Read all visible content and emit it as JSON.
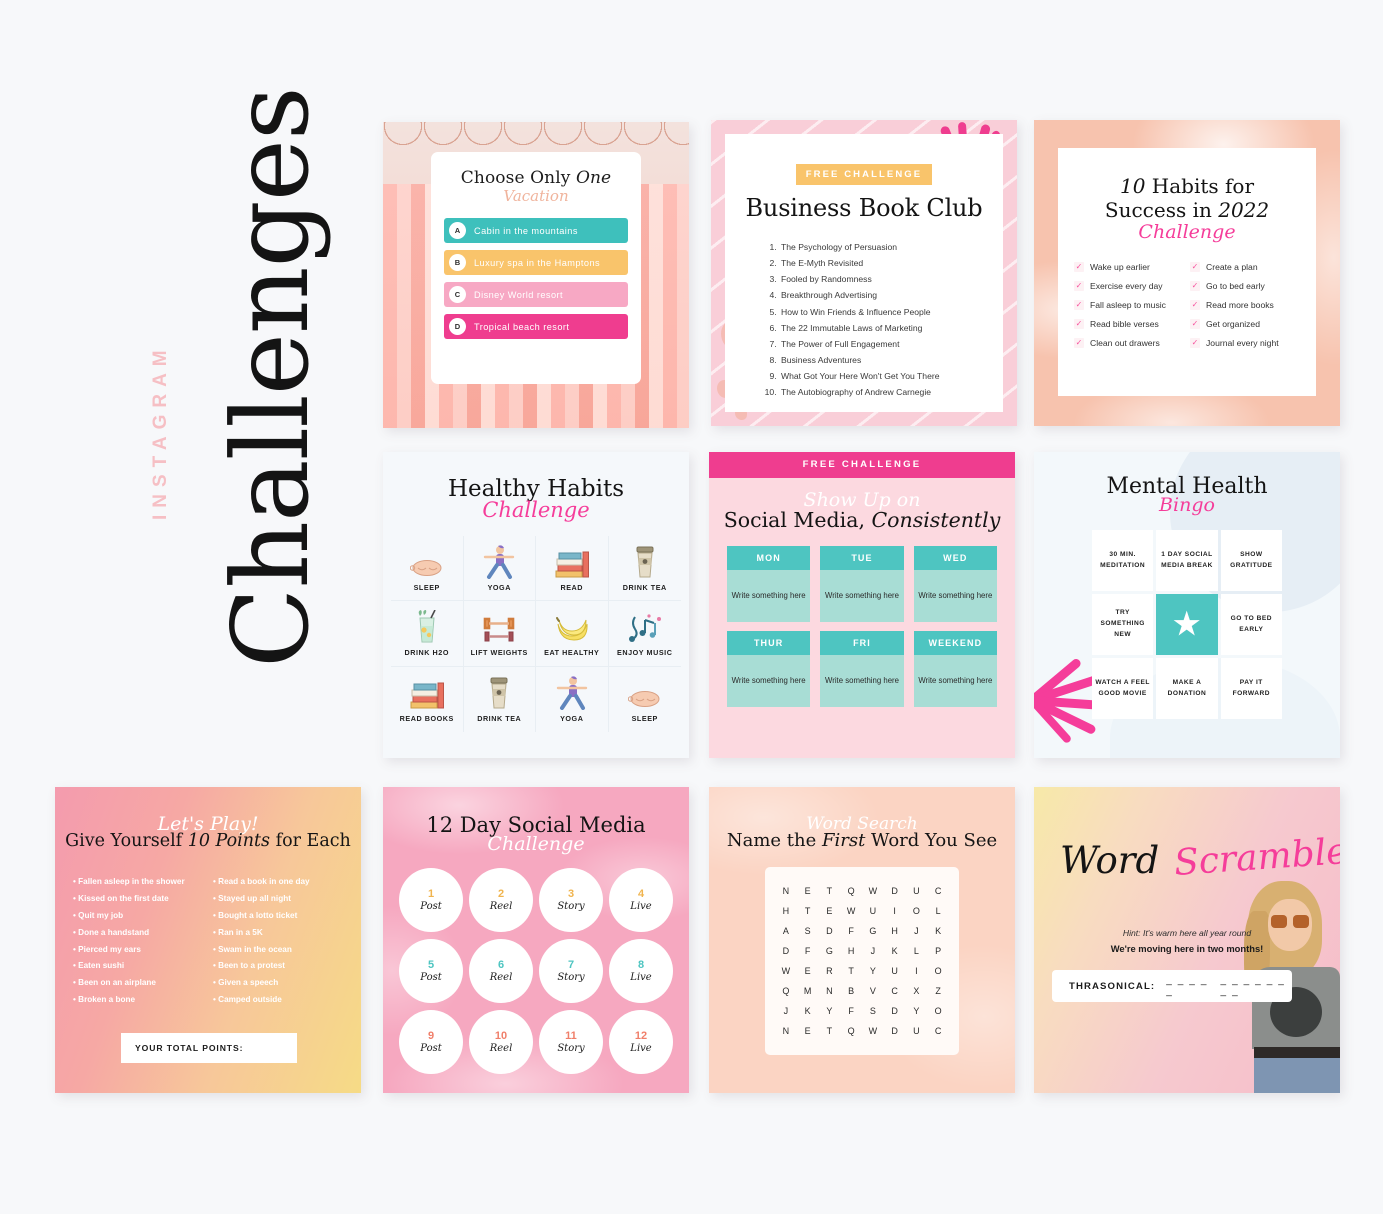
{
  "sidebar": {
    "kicker": "INSTAGRAM",
    "title": "Challenges"
  },
  "colors": {
    "page_background": "#f7f8fa",
    "hot_pink": "#ef3d8f",
    "script_pink": "#f53d9a",
    "teal": "#4ec5c1",
    "mint": "#a8ddd5",
    "amber": "#f9c46b",
    "soft_pink": "#f7a8c4",
    "pale_pink_kicker": "#f6bfc4"
  },
  "cards": {
    "choose_one": {
      "title": "Choose Only ",
      "title_italic": "One",
      "script": "Vacation",
      "options": [
        {
          "badge": "A",
          "label": "Cabin in the mountains",
          "color": "#3ec0bc"
        },
        {
          "badge": "B",
          "label": "Luxury spa in the Hamptons",
          "color": "#f9c46b"
        },
        {
          "badge": "C",
          "label": "Disney World resort",
          "color": "#f7a8c4"
        },
        {
          "badge": "D",
          "label": "Tropical beach resort",
          "color": "#ef3d8f"
        }
      ]
    },
    "book_club": {
      "badge": "FREE CHALLENGE",
      "title": "Business Book Club",
      "books": [
        "The Psychology of Persuasion",
        "The E-Myth Revisited",
        "Fooled by Randomness",
        "Breakthrough Advertising",
        "How to Win Friends & Influence People",
        "The 22 Immutable Laws of Marketing",
        "The Power of Full Engagement",
        "Business Adventures",
        "What Got Your Here Won't Get You There",
        "The Autobiography of Andrew Carnegie"
      ]
    },
    "habits_2022": {
      "title_line1_num": "10",
      "title_line1": " Habits for",
      "title_line2": "Success in ",
      "title_line2_num": "2022",
      "script": "Challenge",
      "checkmark": "✓",
      "items_left": [
        "Wake up earlier",
        "Exercise every day",
        "Fall asleep to music",
        "Read bible verses",
        "Clean out drawers"
      ],
      "items_right": [
        "Create a plan",
        "Go to bed early",
        "Read more books",
        "Get organized",
        "Journal every night"
      ]
    },
    "healthy_habits": {
      "title": "Healthy Habits",
      "script": "Challenge",
      "cells": [
        {
          "label": "SLEEP",
          "icon": "sleep-mask-icon"
        },
        {
          "label": "YOGA",
          "icon": "yoga-pose-icon"
        },
        {
          "label": "READ",
          "icon": "book-stack-icon"
        },
        {
          "label": "DRINK TEA",
          "icon": "coffee-cup-icon"
        },
        {
          "label": "DRINK H2O",
          "icon": "water-glass-icon"
        },
        {
          "label": "LIFT WEIGHTS",
          "icon": "dumbbell-icon"
        },
        {
          "label": "EAT HEALTHY",
          "icon": "banana-icon"
        },
        {
          "label": "ENJOY MUSIC",
          "icon": "music-note-icon"
        },
        {
          "label": "READ BOOKS",
          "icon": "book-stack-icon"
        },
        {
          "label": "DRINK TEA",
          "icon": "coffee-cup-icon"
        },
        {
          "label": "YOGA",
          "icon": "yoga-pose-icon"
        },
        {
          "label": "SLEEP",
          "icon": "sleep-mask-icon"
        }
      ]
    },
    "social_consistently": {
      "badge": "FREE CHALLENGE",
      "script": "Show Up on",
      "title": "Social Media, ",
      "title_italic": "Consistently",
      "placeholder": "Write something here",
      "days": [
        "MON",
        "TUE",
        "WED",
        "THUR",
        "FRI",
        "WEEKEND"
      ]
    },
    "bingo": {
      "title": "Mental Health",
      "script": "Bingo",
      "star_glyph": "★",
      "cells": [
        "30 MIN. MEDITATION",
        "1 DAY SOCIAL MEDIA BREAK",
        "SHOW GRATITUDE",
        "TRY SOMETHING NEW",
        "",
        "GO TO BED EARLY",
        "WATCH A FEEL GOOD MOVIE",
        "MAKE A DONATION",
        "PAY IT FORWARD"
      ]
    },
    "lets_play": {
      "script": "Let's Play!",
      "title_pre": "Give Yourself ",
      "title_num": "10 Points",
      "title_post": " for Each",
      "items_left": [
        "Fallen asleep in the shower",
        "Kissed on the first date",
        "Quit my job",
        "Done a handstand",
        "Pierced my ears",
        "Eaten sushi",
        "Been on an airplane",
        "Broken a bone"
      ],
      "items_right": [
        "Read a book in one day",
        "Stayed up all night",
        "Bought a lotto ticket",
        "Ran in a 5K",
        "Swam in the ocean",
        "Been to a protest",
        "Given a speech",
        "Camped outside"
      ],
      "total_label": "YOUR TOTAL POINTS:"
    },
    "twelve_day": {
      "title": "12 Day Social Media",
      "script": "Challenge",
      "days": [
        {
          "num": "1",
          "label": "Post",
          "color": "#f0b44e"
        },
        {
          "num": "2",
          "label": "Reel",
          "color": "#f0b44e"
        },
        {
          "num": "3",
          "label": "Story",
          "color": "#f0b44e"
        },
        {
          "num": "4",
          "label": "Live",
          "color": "#f0b44e"
        },
        {
          "num": "5",
          "label": "Post",
          "color": "#4ec5c1"
        },
        {
          "num": "6",
          "label": "Reel",
          "color": "#4ec5c1"
        },
        {
          "num": "7",
          "label": "Story",
          "color": "#4ec5c1"
        },
        {
          "num": "8",
          "label": "Live",
          "color": "#4ec5c1"
        },
        {
          "num": "9",
          "label": "Post",
          "color": "#f07f6a"
        },
        {
          "num": "10",
          "label": "Reel",
          "color": "#f07f6a"
        },
        {
          "num": "11",
          "label": "Story",
          "color": "#f07f6a"
        },
        {
          "num": "12",
          "label": "Live",
          "color": "#f07f6a"
        }
      ]
    },
    "word_search": {
      "script": "Word Search",
      "title_pre": "Name the ",
      "title_italic": "First",
      "title_post": " Word You See",
      "grid": [
        [
          "N",
          "E",
          "T",
          "Q",
          "W",
          "D",
          "U",
          "C"
        ],
        [
          "H",
          "T",
          "E",
          "W",
          "U",
          "I",
          "O",
          "L"
        ],
        [
          "A",
          "S",
          "D",
          "F",
          "G",
          "H",
          "J",
          "K"
        ],
        [
          "D",
          "F",
          "G",
          "H",
          "J",
          "K",
          "L",
          "P"
        ],
        [
          "W",
          "E",
          "R",
          "T",
          "Y",
          "U",
          "I",
          "O"
        ],
        [
          "Q",
          "M",
          "N",
          "B",
          "V",
          "C",
          "X",
          "Z"
        ],
        [
          "J",
          "K",
          "Y",
          "F",
          "S",
          "D",
          "Y",
          "O"
        ],
        [
          "N",
          "E",
          "T",
          "Q",
          "W",
          "D",
          "U",
          "C"
        ]
      ]
    },
    "word_scramble": {
      "title": "Word",
      "script": "Scramble",
      "hint": "Hint: It's warm here all year round",
      "subtitle": "We're moving here in two months!",
      "scrambled_word": "THRASONICAL:",
      "blank1": "_ _ _ _ _",
      "blank2": "_ _ _ _ _ _ _ _"
    }
  }
}
